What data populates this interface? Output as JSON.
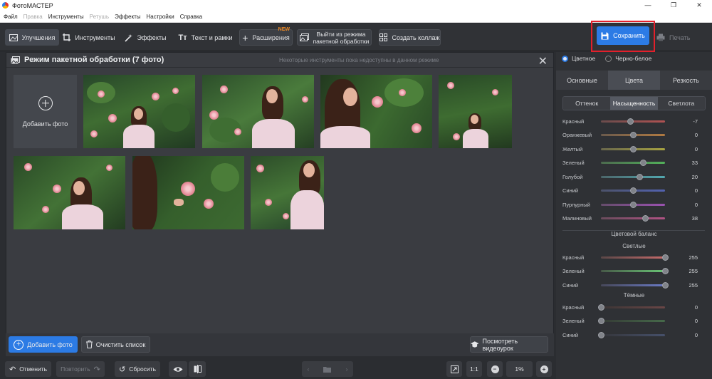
{
  "window": {
    "title": "ФотоМАСТЕР",
    "controls": [
      "—",
      "❐",
      "✕"
    ]
  },
  "menu": [
    {
      "label": "Файл",
      "enabled": true
    },
    {
      "label": "Правка",
      "enabled": false
    },
    {
      "label": "Инструменты",
      "enabled": true
    },
    {
      "label": "Ретушь",
      "enabled": false
    },
    {
      "label": "Эффекты",
      "enabled": true
    },
    {
      "label": "Настройки",
      "enabled": true
    },
    {
      "label": "Справка",
      "enabled": true
    }
  ],
  "toolbar": {
    "enhance": "Улучшения",
    "tools": "Инструменты",
    "effects": "Эффекты",
    "text_frames": "Текст и рамки",
    "extensions": "Расширения",
    "new_badge": "NEW",
    "exit_batch_line1": "Выйти из режима",
    "exit_batch_line2": "пакетной обработки",
    "collage": "Создать коллаж",
    "save": "Сохранить",
    "print": "Печать"
  },
  "batch_panel": {
    "title": "Режим пакетной обработки (7 фото)",
    "note": "Некоторые инструменты пока недоступны в данном режиме",
    "add_tile_label": "Добавить фото",
    "add_button": "Добавить фото",
    "clear_button": "Очистить список",
    "video_button": "Посмотреть видеоурок"
  },
  "status": {
    "undo": "Отменить",
    "redo": "Повторить",
    "reset": "Сбросить",
    "ratio": "1:1",
    "zoom": "1%"
  },
  "sidebar": {
    "mode_color": "Цветное",
    "mode_bw": "Черно-белое",
    "tabs": [
      "Основные",
      "Цвета",
      "Резкость"
    ],
    "active_tab": "Цвета",
    "subtabs": [
      "Оттенок",
      "Насыщенность",
      "Светлота"
    ],
    "active_subtab": "Насыщенность",
    "sliders": [
      {
        "label": "Красный",
        "value": -7
      },
      {
        "label": "Оранжевый",
        "value": 0
      },
      {
        "label": "Желтый",
        "value": 0
      },
      {
        "label": "Зеленый",
        "value": 33
      },
      {
        "label": "Голубой",
        "value": 20
      },
      {
        "label": "Синий",
        "value": 0
      },
      {
        "label": "Пурпурный",
        "value": 0
      },
      {
        "label": "Малиновый",
        "value": 38
      }
    ],
    "balance_title": "Цветовой баланс",
    "lights_title": "Светлые",
    "lights": [
      {
        "label": "Красный",
        "value": 255
      },
      {
        "label": "Зеленый",
        "value": 255
      },
      {
        "label": "Синий",
        "value": 255
      }
    ],
    "darks_title": "Тёмные",
    "darks": [
      {
        "label": "Красный",
        "value": 0
      },
      {
        "label": "Зеленый",
        "value": 0
      },
      {
        "label": "Синий",
        "value": 0
      }
    ]
  },
  "colors": {
    "accent": "#2c7be5",
    "highlight_border": "#e3202b",
    "new_badge": "#f08a24"
  }
}
